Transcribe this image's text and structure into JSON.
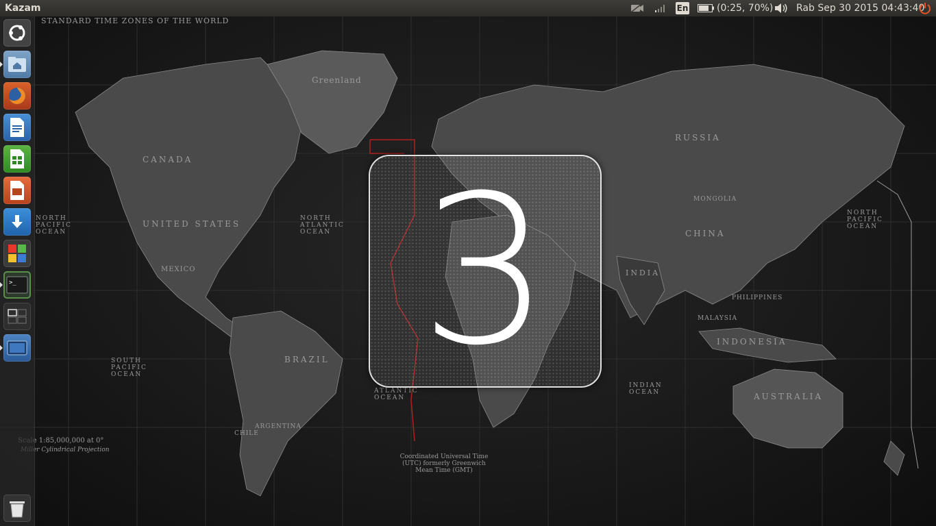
{
  "top_panel": {
    "app_title": "Kazam",
    "keyboard_layout": "En",
    "battery_status": "(0:25, 70%)",
    "clock": "Rab Sep 30 2015 04:43:40",
    "icons": [
      "camera-icon",
      "signal-icon",
      "battery-icon",
      "volume-icon",
      "power-icon"
    ]
  },
  "launcher": {
    "items": [
      {
        "name": "ubuntu-dash",
        "icon": "ubuntu-logo-icon",
        "active": false
      },
      {
        "name": "files",
        "icon": "home-folder-icon",
        "active": true
      },
      {
        "name": "firefox",
        "icon": "firefox-icon",
        "active": false
      },
      {
        "name": "libreoffice-writer",
        "icon": "writer-icon",
        "active": false
      },
      {
        "name": "libreoffice-calc",
        "icon": "calc-icon",
        "active": false
      },
      {
        "name": "libreoffice-impress",
        "icon": "impress-icon",
        "active": false
      },
      {
        "name": "software-updater",
        "icon": "download-arrow-icon",
        "active": false
      },
      {
        "name": "ubuntu-software",
        "icon": "software-center-icon",
        "active": false
      },
      {
        "name": "terminal",
        "icon": "terminal-icon",
        "active": true
      },
      {
        "name": "workspace-switcher",
        "icon": "workspaces-icon",
        "active": false
      },
      {
        "name": "kazam",
        "icon": "kazam-icon",
        "active": true
      },
      {
        "name": "trash",
        "icon": "trash-icon",
        "active": false
      }
    ]
  },
  "wallpaper": {
    "header": "STANDARD TIME ZONES OF THE WORLD",
    "labels": {
      "canada": "CANADA",
      "united_states": "UNITED STATES",
      "mexico": "MEXICO",
      "brazil": "BRAZIL",
      "argentina": "ARGENTINA",
      "chile": "CHILE",
      "greenland": "Greenland",
      "russia": "RUSSIA",
      "mongolia": "MONGOLIA",
      "china": "CHINA",
      "india": "INDIA",
      "indonesia": "INDONESIA",
      "australia": "AUSTRALIA",
      "philippines": "PHILIPPINES",
      "malaysia": "MALAYSIA",
      "north_pacific": "NORTH PACIFIC OCEAN",
      "south_pacific": "SOUTH PACIFIC OCEAN",
      "north_atlantic": "NORTH ATLANTIC OCEAN",
      "indian_ocean": "INDIAN OCEAN",
      "atlantic": "ATLANTIC OCEAN",
      "scale": "Scale 1:85,000,000 at 0°",
      "projection": "Miller Cylindrical Projection",
      "utc_note": "Coordinated Universal Time (UTC) formerly Greenwich Mean Time (GMT)"
    }
  },
  "countdown": {
    "value": "3"
  }
}
